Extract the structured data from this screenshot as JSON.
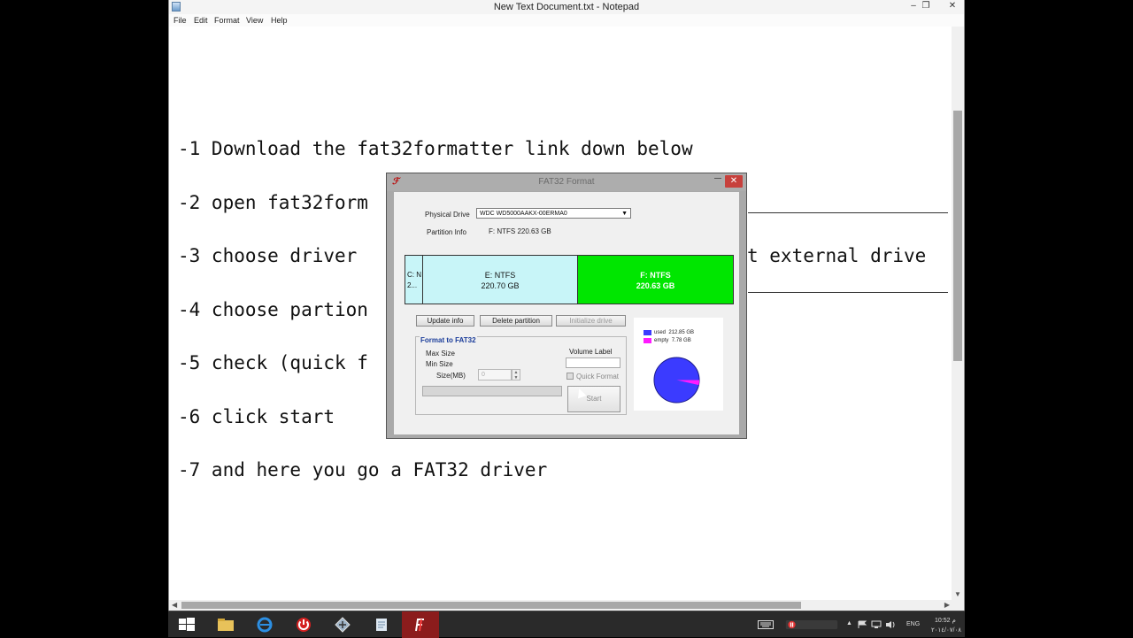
{
  "notepad": {
    "title": "New Text Document.txt - Notepad",
    "window_buttons": {
      "minimize": "–",
      "restore": "❐",
      "close": "✕"
    },
    "menu": [
      "File",
      "Edit",
      "Format",
      "View",
      "Help"
    ],
    "lines": [
      "-1 Download the fat32formatter link down below",
      "-2 open fat32form",
      "-3 choose driver",
      "t external drive",
      "-4 choose partion",
      "-5 check (quick f",
      "-6 click start",
      "-7 and here you go a FAT32 driver"
    ]
  },
  "dialog": {
    "title": "FAT32 Format",
    "close_label": "✕",
    "physical_drive_label": "Physical Drive",
    "physical_drive_value": "WDC WD5000AAKX-00ERMA0",
    "partition_info_label": "Partition Info",
    "partition_info_value": "F: NTFS  220.63 GB",
    "partitions": [
      {
        "name": "C: N",
        "size": "2..."
      },
      {
        "name": "E: NTFS",
        "size": "220.70 GB"
      },
      {
        "name": "F: NTFS",
        "size": "220.63 GB"
      }
    ],
    "buttons": {
      "update_info": "Update info",
      "delete_partition": "Delete partition",
      "initialize_drive": "Initialize drive",
      "start": "Start"
    },
    "format_group_title": "Format to FAT32",
    "max_size_label": "Max Size",
    "min_size_label": "Min Size",
    "size_label": "Size(MB)",
    "size_value": "0",
    "volume_label_label": "Volume Label",
    "quick_format_label": "Quick Format",
    "legend": [
      {
        "label": "used",
        "value": "212.85 GB",
        "color": "#3b3bff"
      },
      {
        "label": "empty",
        "value": "7.78 GB",
        "color": "#ff1aff"
      }
    ],
    "usage": {
      "used_gb": 212.85,
      "empty_gb": 7.78
    },
    "colors": {
      "selected_partition": "#00e600",
      "partition": "#c8f5f8",
      "group_title": "#1a3c9a"
    }
  },
  "taskbar": {
    "language": "ENG",
    "time": "10:52 م",
    "date": "٢٠١٤/٠٧/٠٨"
  }
}
